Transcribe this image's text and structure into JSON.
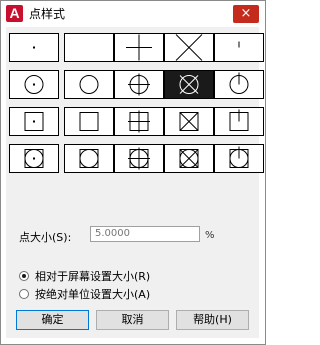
{
  "window": {
    "title": "点样式",
    "app_icon": "A",
    "close_glyph": "×"
  },
  "point_styles": {
    "selected_index": 8,
    "cells": [
      {
        "name": "dot",
        "base": "dot",
        "frame": "none"
      },
      {
        "name": "none",
        "base": "none",
        "frame": "none"
      },
      {
        "name": "plus",
        "base": "plus",
        "frame": "none"
      },
      {
        "name": "x",
        "base": "x",
        "frame": "none"
      },
      {
        "name": "tick",
        "base": "tick",
        "frame": "none"
      },
      {
        "name": "circle-dot",
        "base": "dot",
        "frame": "circle"
      },
      {
        "name": "circle",
        "base": "none",
        "frame": "circle"
      },
      {
        "name": "circle-plus",
        "base": "plus",
        "frame": "circle"
      },
      {
        "name": "circle-x",
        "base": "x",
        "frame": "circle"
      },
      {
        "name": "circle-tick",
        "base": "tick",
        "frame": "circle"
      },
      {
        "name": "square-dot",
        "base": "dot",
        "frame": "square"
      },
      {
        "name": "square",
        "base": "none",
        "frame": "square"
      },
      {
        "name": "square-plus",
        "base": "plus",
        "frame": "square"
      },
      {
        "name": "square-x",
        "base": "x",
        "frame": "square"
      },
      {
        "name": "square-tick",
        "base": "tick",
        "frame": "square"
      },
      {
        "name": "circle-square-dot",
        "base": "dot",
        "frame": "both"
      },
      {
        "name": "circle-square",
        "base": "none",
        "frame": "both"
      },
      {
        "name": "circle-square-plus",
        "base": "plus",
        "frame": "both"
      },
      {
        "name": "circle-square-x",
        "base": "x",
        "frame": "both"
      },
      {
        "name": "circle-square-tick",
        "base": "tick",
        "frame": "both"
      }
    ]
  },
  "size": {
    "label": "点大小(S):",
    "value": "5.0000",
    "unit": "%"
  },
  "mode": {
    "relative_label": "相对于屏幕设置大小(R)",
    "absolute_label": "按绝对单位设置大小(A)",
    "selected": "relative"
  },
  "buttons": {
    "ok": "确定",
    "cancel": "取消",
    "help": "帮助(H)"
  }
}
